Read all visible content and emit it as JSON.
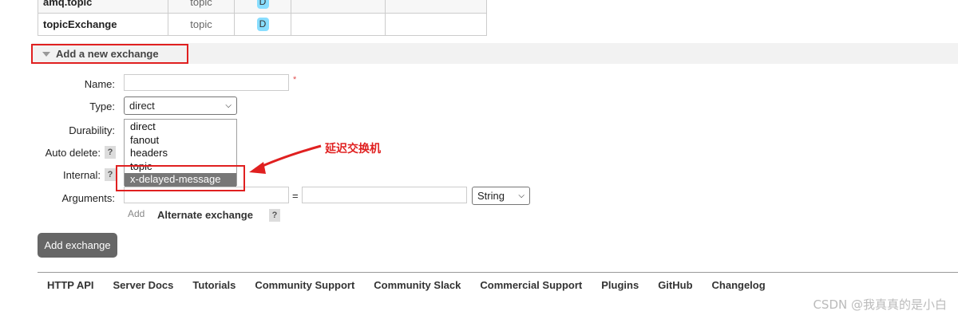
{
  "exchanges": [
    {
      "name": "amq.topic",
      "type": "topic",
      "badge": "D"
    },
    {
      "name": "topicExchange",
      "type": "topic",
      "badge": "D"
    }
  ],
  "section": {
    "title": "Add a new exchange"
  },
  "form": {
    "name_label": "Name:",
    "name_value": "",
    "required_mark": "*",
    "type_label": "Type:",
    "type_value": "direct",
    "type_options": [
      "direct",
      "fanout",
      "headers",
      "topic",
      "x-delayed-message"
    ],
    "durability_label": "Durability:",
    "auto_delete_label": "Auto delete:",
    "internal_label": "Internal:",
    "arguments_label": "Arguments:",
    "help": "?",
    "equals": "=",
    "arg_type_value": "String",
    "add_link": "Add",
    "alternate_exchange": "Alternate exchange",
    "submit": "Add exchange"
  },
  "annotation": "延迟交换机",
  "footer": [
    "HTTP API",
    "Server Docs",
    "Tutorials",
    "Community Support",
    "Community Slack",
    "Commercial Support",
    "Plugins",
    "GitHub",
    "Changelog"
  ],
  "watermark": "CSDN @我真真的是小白",
  "colors": {
    "highlight": "#e02020",
    "badge": "#88ddff",
    "button": "#666666"
  }
}
